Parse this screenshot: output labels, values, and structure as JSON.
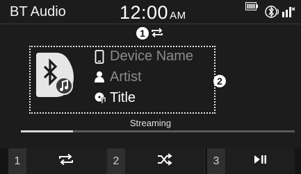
{
  "header": {
    "app_title": "BT Audio",
    "time": "12:00",
    "ampm": "AM"
  },
  "callouts": {
    "one": "1",
    "two": "2"
  },
  "track": {
    "device_name": "Device Name",
    "artist": "Artist",
    "title": "Title"
  },
  "playback": {
    "streaming_label": "Streaming",
    "progress_percent": 19
  },
  "controls": [
    {
      "index": "1",
      "icon": "repeat-icon"
    },
    {
      "index": "2",
      "icon": "shuffle-icon"
    },
    {
      "index": "3",
      "icon": "play-pause-icon"
    }
  ],
  "colors": {
    "background": "#1c1c1c",
    "text_primary": "#ffffff",
    "text_dim": "#8c8c8c",
    "control_bar": "#141414"
  }
}
